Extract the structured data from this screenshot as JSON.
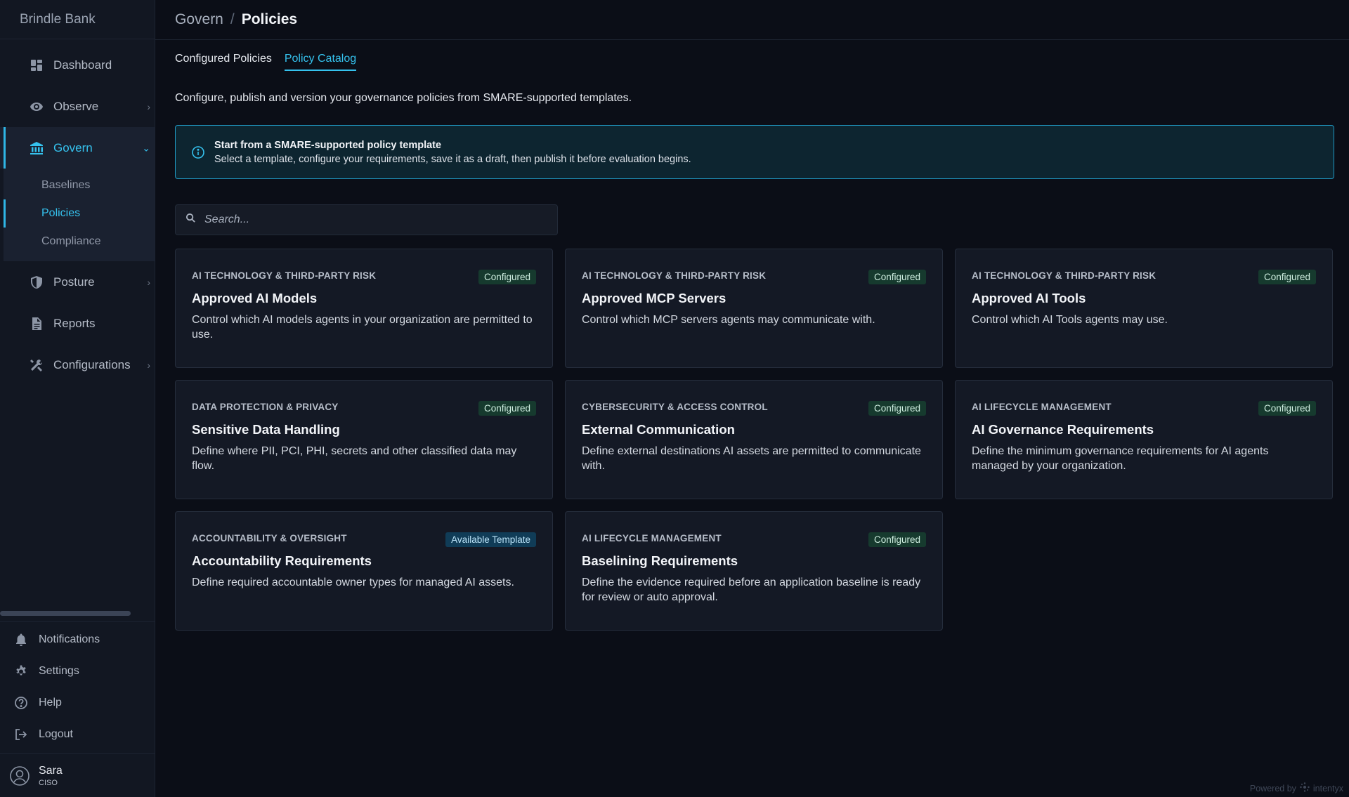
{
  "brand": "Brindle Bank",
  "sidebar": {
    "items": [
      {
        "label": "Dashboard",
        "icon": "grid-icon"
      },
      {
        "label": "Observe",
        "icon": "eye-icon"
      },
      {
        "label": "Govern",
        "icon": "bank-icon"
      },
      {
        "label": "Posture",
        "icon": "shield-icon"
      },
      {
        "label": "Reports",
        "icon": "document-icon"
      },
      {
        "label": "Configurations",
        "icon": "tools-icon"
      }
    ],
    "govern_sub": [
      {
        "label": "Baselines"
      },
      {
        "label": "Policies"
      },
      {
        "label": "Compliance"
      }
    ],
    "bottom": [
      {
        "label": "Notifications",
        "icon": "bell-icon"
      },
      {
        "label": "Settings",
        "icon": "gear-icon"
      },
      {
        "label": "Help",
        "icon": "help-icon"
      },
      {
        "label": "Logout",
        "icon": "logout-icon"
      }
    ],
    "user": {
      "name": "Sara",
      "role": "CISO"
    }
  },
  "header": {
    "breadcrumb": [
      "Govern",
      "/",
      "Policies"
    ]
  },
  "tabs": [
    {
      "label": "Configured Policies"
    },
    {
      "label": "Policy Catalog"
    }
  ],
  "main": {
    "description": "Configure, publish and version your governance policies from SMARE-supported templates.",
    "banner": {
      "title": "Start from a SMARE-supported policy template",
      "text": "Select a template, configure your requirements, save it as a draft, then publish it before evaluation begins."
    },
    "search": {
      "placeholder": "Search..."
    },
    "cards": [
      {
        "category": "AI TECHNOLOGY & THIRD-PARTY RISK",
        "badge": "Configured",
        "title": "Approved AI Models",
        "description": "Control which AI models agents in your organization are permitted to use."
      },
      {
        "category": "AI TECHNOLOGY & THIRD-PARTY RISK",
        "badge": "Configured",
        "title": "Approved MCP Servers",
        "description": "Control which MCP servers agents may communicate with."
      },
      {
        "category": "AI TECHNOLOGY & THIRD-PARTY RISK",
        "badge": "Configured",
        "title": "Approved AI Tools",
        "description": "Control which AI Tools agents may use."
      },
      {
        "category": "DATA PROTECTION & PRIVACY",
        "badge": "Configured",
        "title": "Sensitive Data Handling",
        "description": "Define where PII, PCI, PHI, secrets and other classified data may flow."
      },
      {
        "category": "CYBERSECURITY & ACCESS CONTROL",
        "badge": "Configured",
        "title": "External Communication",
        "description": "Define external destinations AI assets are permitted to communicate with."
      },
      {
        "category": "AI LIFECYCLE MANAGEMENT",
        "badge": "Configured",
        "title": "AI Governance Requirements",
        "description": "Define the minimum governance requirements for AI agents managed by your organization."
      },
      {
        "category": "ACCOUNTABILITY & OVERSIGHT",
        "badge": "Available Template",
        "title": "Accountability Requirements",
        "description": "Define required accountable owner types for managed AI assets."
      },
      {
        "category": "AI LIFECYCLE MANAGEMENT",
        "badge": "Configured",
        "title": "Baselining Requirements",
        "description": "Define the evidence required before an application baseline is ready for review or auto approval."
      }
    ]
  },
  "footer": {
    "powered_by": "Powered by",
    "vendor": "intentyx"
  },
  "colors": {
    "accent": "#35c2ee",
    "configured_badge": "#163a2e",
    "available_badge": "#103c57"
  }
}
